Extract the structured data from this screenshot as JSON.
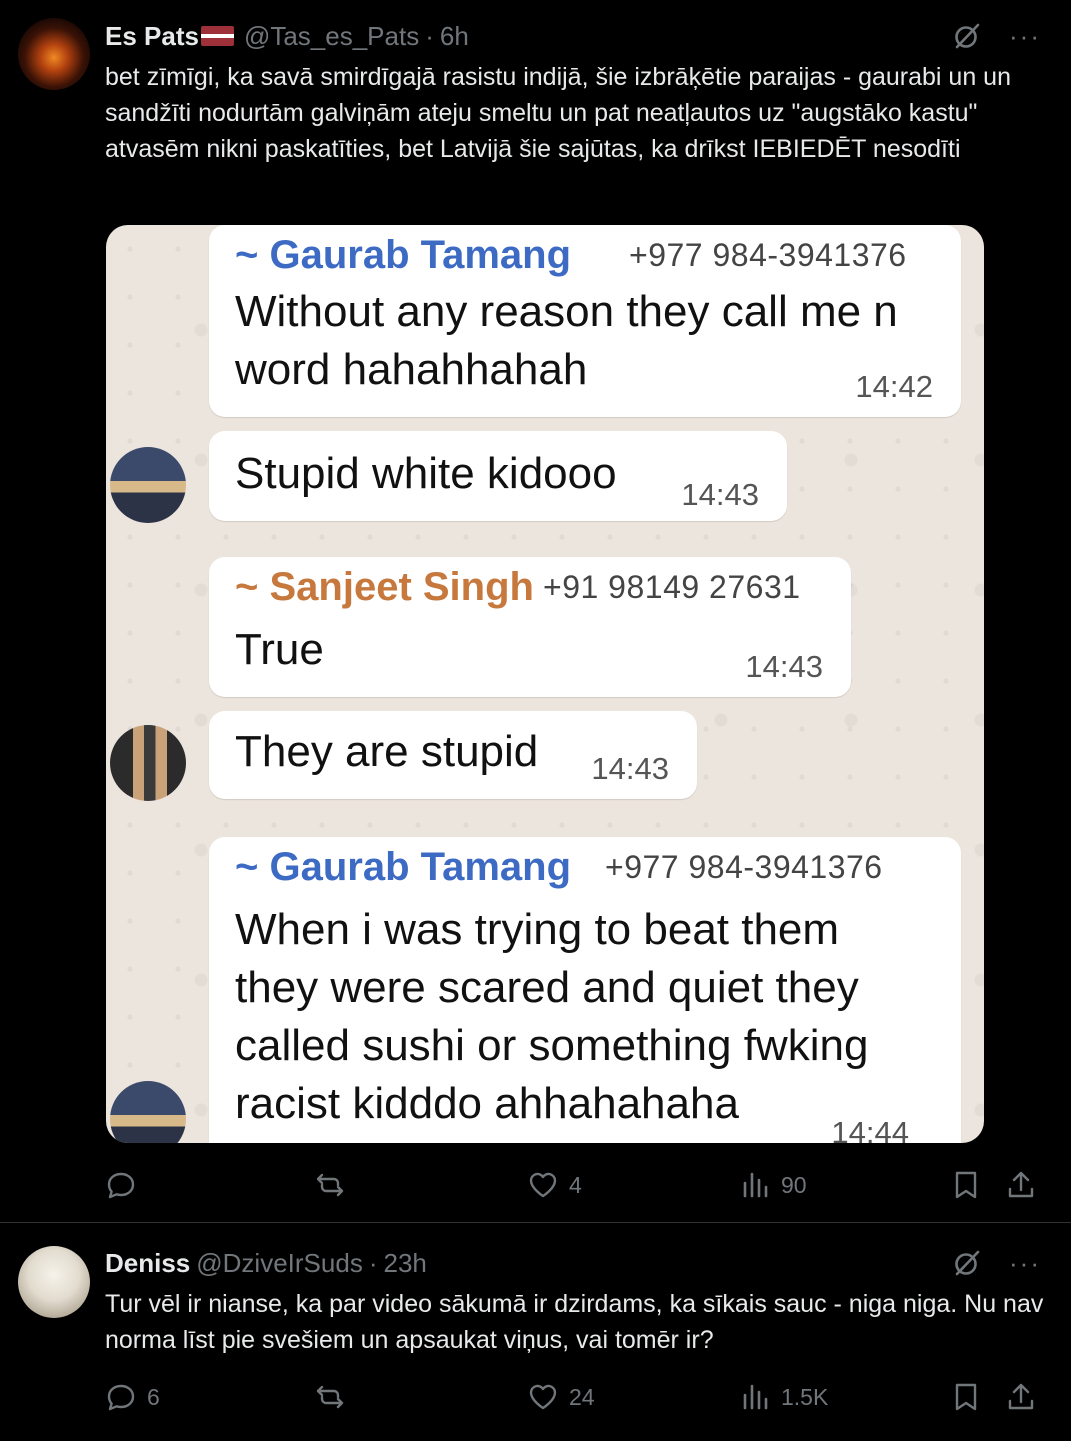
{
  "tweet1": {
    "name": "Es Pats",
    "flag": "latvia-flag",
    "handle": "@Tas_es_Pats",
    "time": "6h",
    "more": "···",
    "text": "bet zīmīgi, ka savā smirdīgajā rasistu indijā, šie izbrāķētie paraijas - gaurabi un un sandžīti nodurtām galviņām ateju smeltu un pat neatļautos uz \"augstāko kastu\" atvasēm nikni paskatīties, bet Latvijā šie sajūtas, ka drīkst IEBIEDĒT nesodīti",
    "media": {
      "messages": [
        {
          "sender": "~ Gaurab Tamang",
          "phone": "+977 984-3941376",
          "text_lines": [
            "Without any reason they call me n",
            "word hahahhahah"
          ],
          "time": "14:42"
        },
        {
          "text_lines": [
            "Stupid white kidooo"
          ],
          "time": "14:43"
        },
        {
          "sender": "~ Sanjeet Singh",
          "phone": "+91 98149 27631",
          "text_lines": [
            "True"
          ],
          "time": "14:43"
        },
        {
          "text_lines": [
            "They are stupid"
          ],
          "time": "14:43"
        },
        {
          "sender": "~ Gaurab Tamang",
          "phone": "+977 984-3941376",
          "text_lines": [
            "When i was trying to beat them",
            "they were scared and quiet they",
            "called sushi or something fwking",
            "racist kidddo ahhahahaha"
          ],
          "time": "14:44"
        }
      ]
    },
    "actions": {
      "reply": "",
      "retweet": "",
      "like": "4",
      "views": "90"
    }
  },
  "tweet2": {
    "name": "Deniss",
    "handle": "@DziveIrSuds",
    "time": "23h",
    "more": "···",
    "text": "Tur vēl ir nianse, ka par video sākumā ir dzirdams, ka sīkais sauc - niga niga. Nu nav norma līst pie svešiem un apsaukat viņus, vai tomēr ir?",
    "actions": {
      "reply": "6",
      "retweet": "",
      "like": "24",
      "views": "1.5K"
    }
  },
  "colors": {
    "background": "#000000",
    "text": "#e7e9ea",
    "muted": "#71767b",
    "chat_blue": "#3d6bc4",
    "chat_orange": "#c7783d"
  }
}
